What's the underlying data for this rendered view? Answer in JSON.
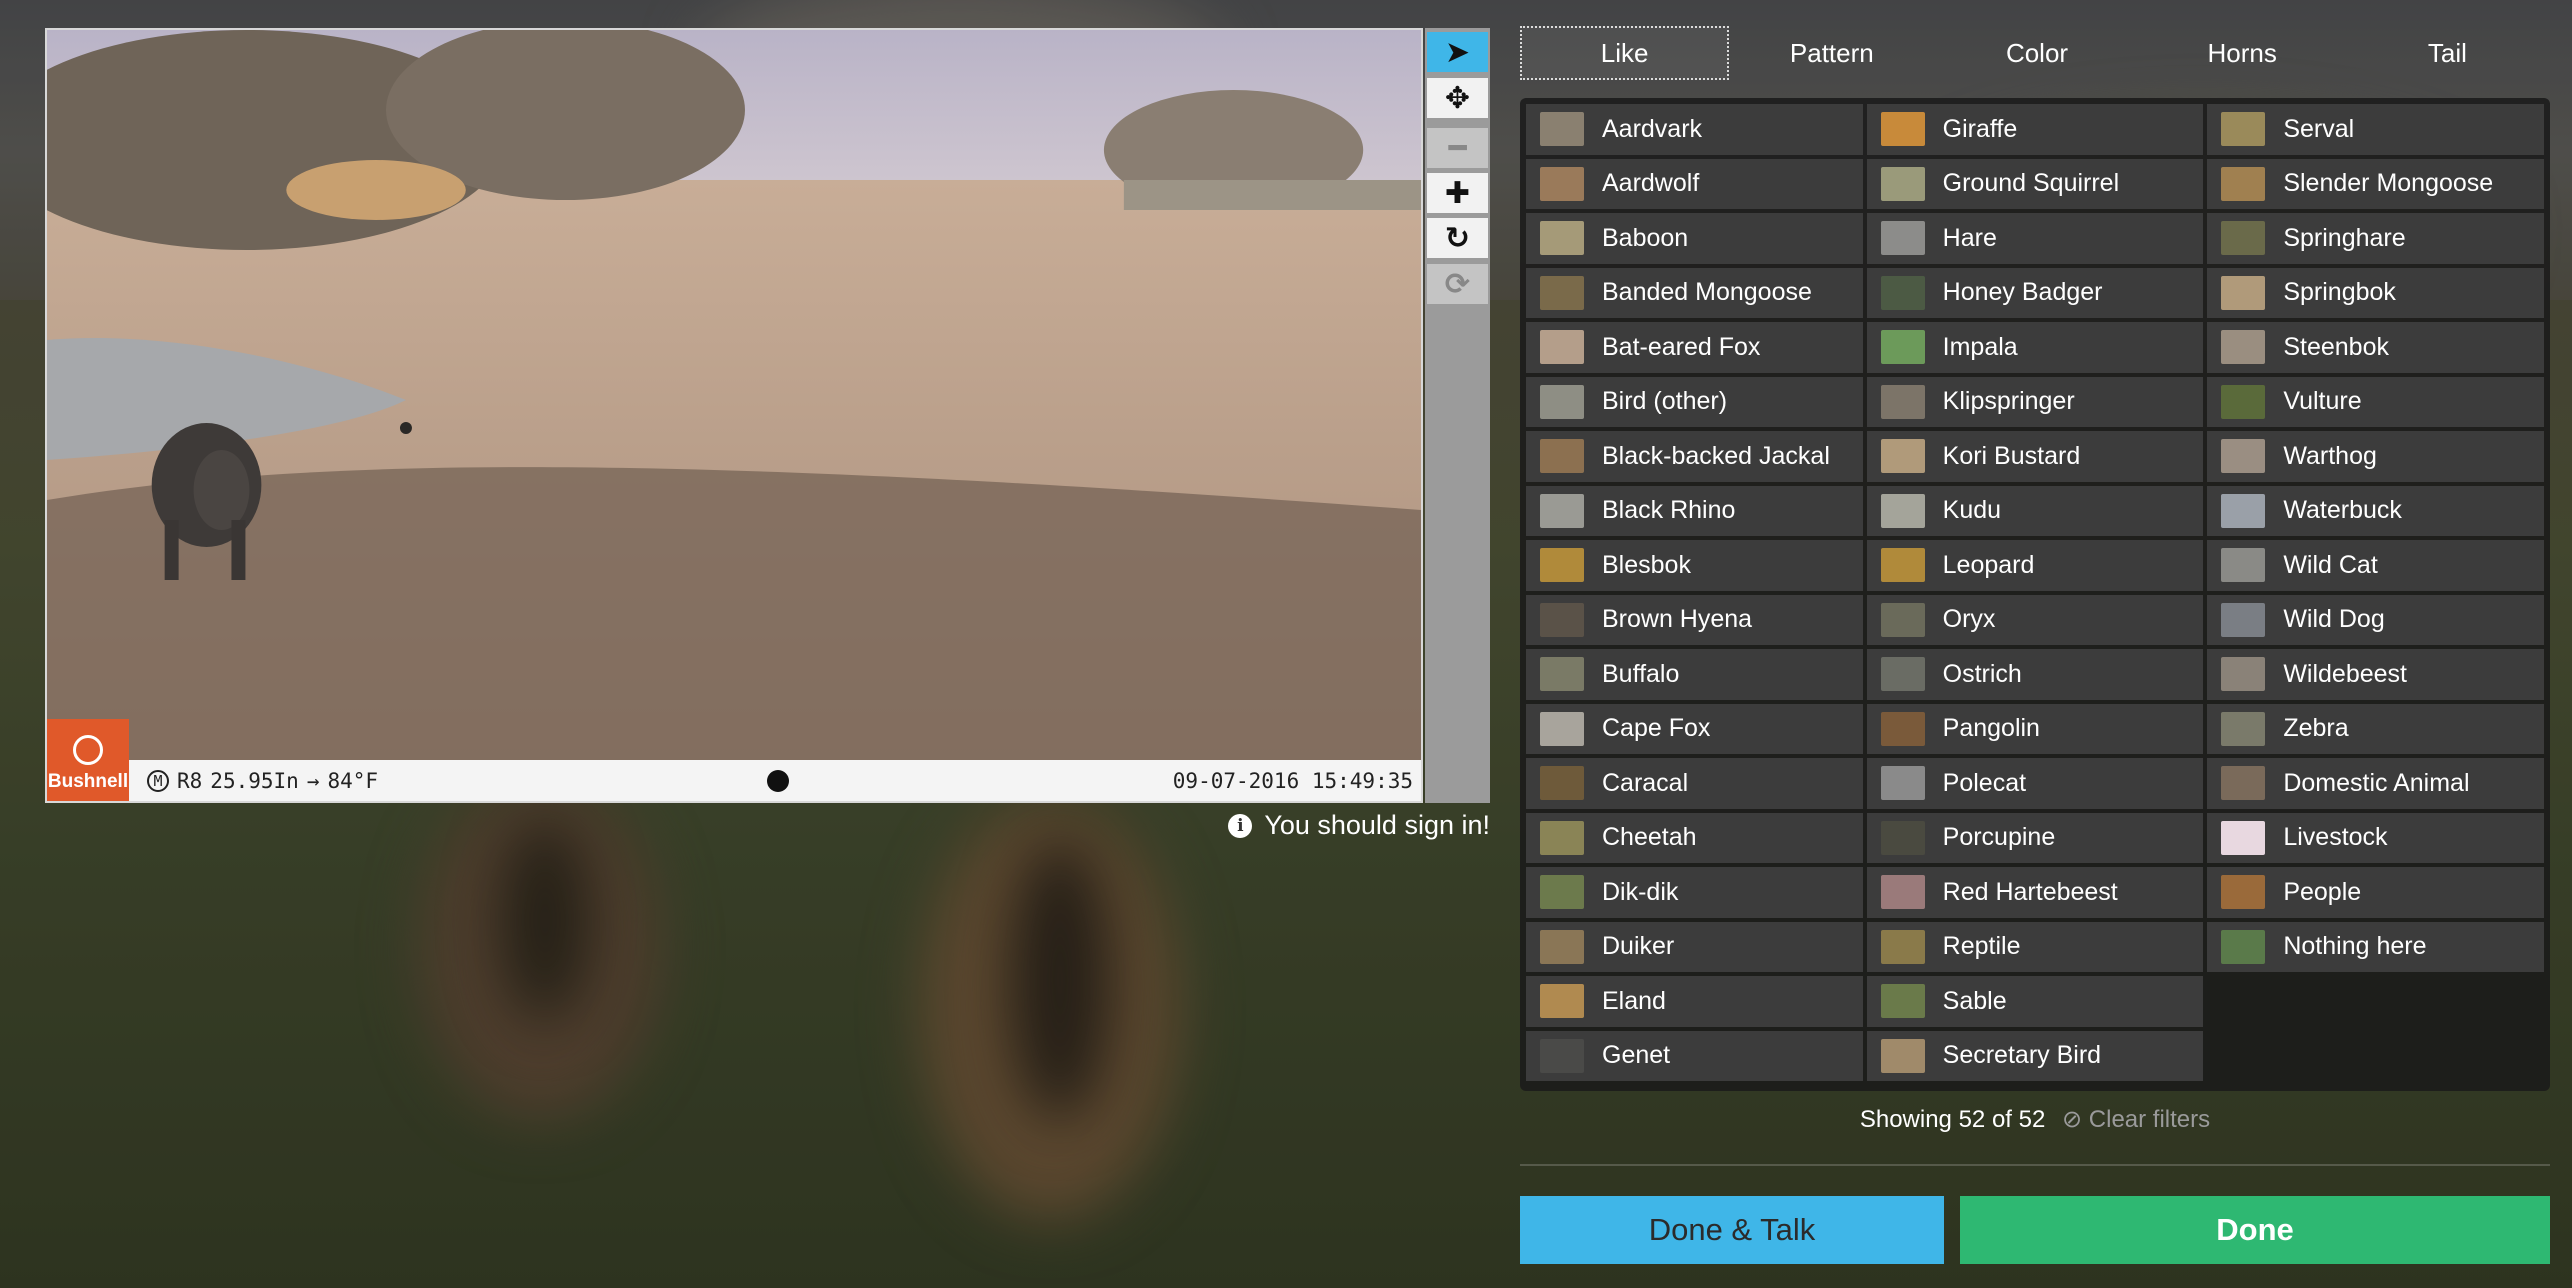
{
  "colors": {
    "accent_blue": "#3fb6e8",
    "done_green": "#2eb872",
    "brand_orange": "#e0592a",
    "choice_bg": "#3c3c3c"
  },
  "photo": {
    "brand": "Bushnell",
    "camera_id": "R8",
    "pressure": "25.95In",
    "trend_arrow": "→",
    "temperature": "84°F",
    "moon_mode": "M",
    "timestamp": "09-07-2016 15:49:35"
  },
  "toolbar": [
    {
      "name": "select-tool",
      "icon": "cursor-icon",
      "glyph": "➤",
      "state": "active"
    },
    {
      "name": "pan-tool",
      "icon": "move-icon",
      "glyph": "✥",
      "state": "normal"
    },
    {
      "name": "zoom-out-tool",
      "icon": "minus-icon",
      "glyph": "━",
      "state": "disabled"
    },
    {
      "name": "zoom-in-tool",
      "icon": "plus-icon",
      "glyph": "✚",
      "state": "normal"
    },
    {
      "name": "rotate-tool",
      "icon": "rotate-icon",
      "glyph": "↻",
      "state": "normal"
    },
    {
      "name": "reset-tool",
      "icon": "refresh-icon",
      "glyph": "⟳",
      "state": "disabled"
    }
  ],
  "signin_message": "You should sign in!",
  "tabs": [
    "Like",
    "Pattern",
    "Color",
    "Horns",
    "Tail"
  ],
  "active_tab": "Like",
  "choices": [
    {
      "label": "Aardvark",
      "thumb": "#8a8070"
    },
    {
      "label": "Aardwolf",
      "thumb": "#9a7a5a"
    },
    {
      "label": "Baboon",
      "thumb": "#a59a78"
    },
    {
      "label": "Banded Mongoose",
      "thumb": "#7a6a4a"
    },
    {
      "label": "Bat-eared Fox",
      "thumb": "#b49e8a"
    },
    {
      "label": "Bird (other)",
      "thumb": "#8e8e84"
    },
    {
      "label": "Black-backed Jackal",
      "thumb": "#8c7050"
    },
    {
      "label": "Black Rhino",
      "thumb": "#9a9a94"
    },
    {
      "label": "Blesbok",
      "thumb": "#b08a3a"
    },
    {
      "label": "Brown Hyena",
      "thumb": "#5a5248"
    },
    {
      "label": "Buffalo",
      "thumb": "#7a7a66"
    },
    {
      "label": "Cape Fox",
      "thumb": "#a8a49c"
    },
    {
      "label": "Caracal",
      "thumb": "#6e5a3a"
    },
    {
      "label": "Cheetah",
      "thumb": "#8a8456"
    },
    {
      "label": "Dik-dik",
      "thumb": "#6c7a4c"
    },
    {
      "label": "Duiker",
      "thumb": "#8a7656"
    },
    {
      "label": "Eland",
      "thumb": "#b08a50"
    },
    {
      "label": "Genet",
      "thumb": "#4a4a48"
    },
    {
      "label": "Giraffe",
      "thumb": "#c88a3a"
    },
    {
      "label": "Ground Squirrel",
      "thumb": "#9a9a7a"
    },
    {
      "label": "Hare",
      "thumb": "#8c8c8a"
    },
    {
      "label": "Honey Badger",
      "thumb": "#4c5a44"
    },
    {
      "label": "Impala",
      "thumb": "#6c9a5a"
    },
    {
      "label": "Klipspringer",
      "thumb": "#7c7468"
    },
    {
      "label": "Kori Bustard",
      "thumb": "#b09a7a"
    },
    {
      "label": "Kudu",
      "thumb": "#a4a49a"
    },
    {
      "label": "Leopard",
      "thumb": "#b08a3a"
    },
    {
      "label": "Oryx",
      "thumb": "#6a6a5a"
    },
    {
      "label": "Ostrich",
      "thumb": "#6a6c64"
    },
    {
      "label": "Pangolin",
      "thumb": "#7a5a3a"
    },
    {
      "label": "Polecat",
      "thumb": "#8a8a8a"
    },
    {
      "label": "Porcupine",
      "thumb": "#4a4a40"
    },
    {
      "label": "Red Hartebeest",
      "thumb": "#9a7a7a"
    },
    {
      "label": "Reptile",
      "thumb": "#8a7a4a"
    },
    {
      "label": "Sable",
      "thumb": "#6a7a4a"
    },
    {
      "label": "Secretary Bird",
      "thumb": "#a08a6a"
    },
    {
      "label": "Serval",
      "thumb": "#9a8a5a"
    },
    {
      "label": "Slender Mongoose",
      "thumb": "#a08050"
    },
    {
      "label": "Springhare",
      "thumb": "#6a6a4a"
    },
    {
      "label": "Springbok",
      "thumb": "#b09a7a"
    },
    {
      "label": "Steenbok",
      "thumb": "#9a8e80"
    },
    {
      "label": "Vulture",
      "thumb": "#5a6a3a"
    },
    {
      "label": "Warthog",
      "thumb": "#9a8e82"
    },
    {
      "label": "Waterbuck",
      "thumb": "#9aa0a8"
    },
    {
      "label": "Wild Cat",
      "thumb": "#8a8a86"
    },
    {
      "label": "Wild Dog",
      "thumb": "#7a7e84"
    },
    {
      "label": "Wildebeest",
      "thumb": "#8a8278"
    },
    {
      "label": "Zebra",
      "thumb": "#7a7a6a"
    },
    {
      "label": "Domestic Animal",
      "thumb": "#7a6a5a"
    },
    {
      "label": "Livestock",
      "thumb": "#e8d8e0"
    },
    {
      "label": "People",
      "thumb": "#9a6a3a"
    },
    {
      "label": "Nothing here",
      "thumb": "#5a7a4a"
    }
  ],
  "filter_status": {
    "showing_text": "Showing 52 of 52",
    "clear_icon": "⊘",
    "clear_label": "Clear filters"
  },
  "buttons": {
    "done_talk": "Done & Talk",
    "done": "Done"
  }
}
